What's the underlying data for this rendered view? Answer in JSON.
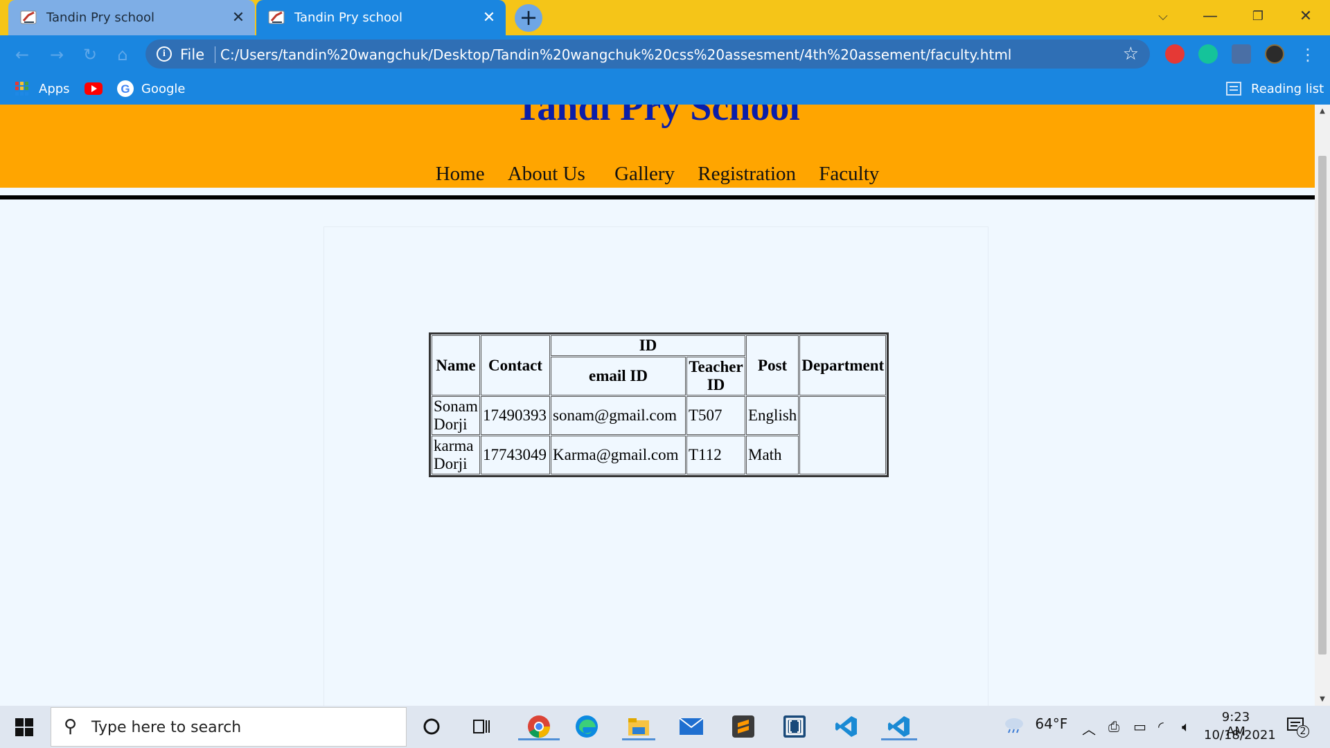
{
  "browser": {
    "tabs": [
      {
        "title": "Tandin Pry school",
        "active": false
      },
      {
        "title": "Tandin Pry school",
        "active": true
      }
    ],
    "new_tab_symbol": "+",
    "scheme_label": "File",
    "url": "C:/Users/tandin%20wangchuk/Desktop/Tandin%20wangchuk%20css%20assesment/4th%20assement/faculty.html",
    "bookmarks": {
      "apps": "Apps",
      "google": "Google",
      "reading_list": "Reading list"
    },
    "colors": {
      "tab_strip": "#f5c518",
      "toolbar": "#1a86e0",
      "active_tab": "#1a86e0",
      "inactive_tab": "#7eaee6"
    }
  },
  "page": {
    "site_title": "Tandi Pry School",
    "nav": [
      "Home",
      "About Us",
      "Gallery",
      "Registration",
      "Faculty"
    ],
    "table": {
      "headers": {
        "name": "Name",
        "contact": "Contact",
        "id": "ID",
        "email_id": "email ID",
        "teacher_id_line1": "Teacher",
        "teacher_id_line2": "ID",
        "post": "Post",
        "department": "Department"
      },
      "rows": [
        {
          "name_line1": "Sonam",
          "name_line2": "Dorji",
          "contact": "17490393",
          "email": "sonam@gmail.com",
          "teacher_id": "T507",
          "post": "English"
        },
        {
          "name_line1": "karma",
          "name_line2": "Dorji",
          "contact": "17743049",
          "email": "Karma@gmail.com",
          "teacher_id": "T112",
          "post": "Math"
        }
      ]
    },
    "colors": {
      "header_bg": "#ffa500",
      "title_color": "#0b1ea8",
      "page_bg": "#f0f8ff"
    }
  },
  "taskbar": {
    "search_placeholder": "Type here to search",
    "weather": "64°F",
    "time": "9:23 AM",
    "date": "10/18/2021",
    "notifications_count": "2",
    "apps": [
      "cortana-icon",
      "task-view-icon",
      "chrome-icon",
      "edge-icon",
      "file-explorer-icon",
      "mail-icon",
      "sublime-text-icon",
      "brackets-icon",
      "vscode-icon",
      "vscode-icon"
    ]
  }
}
